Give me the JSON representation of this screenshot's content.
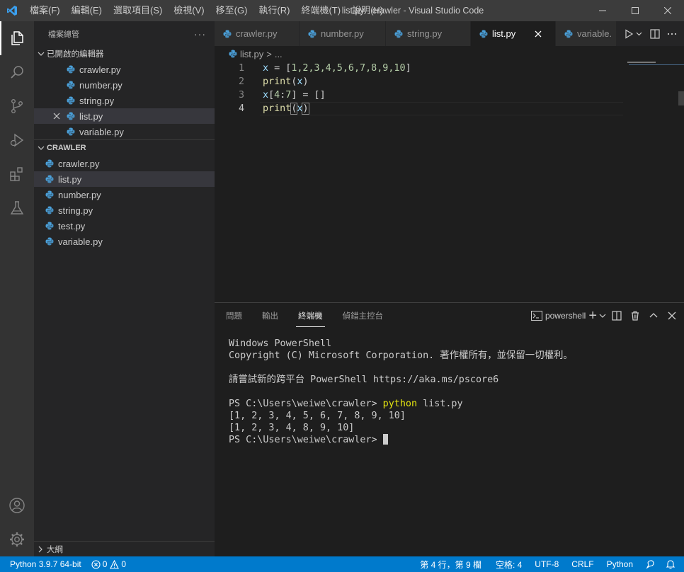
{
  "titlebar": {
    "menu": [
      "檔案(F)",
      "編輯(E)",
      "選取項目(S)",
      "檢視(V)",
      "移至(G)",
      "執行(R)",
      "終端機(T)",
      "說明(H)"
    ],
    "title": "list.py - crawler - Visual Studio Code"
  },
  "sidebar": {
    "header": "檔案總管",
    "more": "···",
    "open_editors_title": "已開啟的編輯器",
    "open_editors": [
      "crawler.py",
      "number.py",
      "string.py",
      "list.py",
      "variable.py"
    ],
    "folder_title": "CRAWLER",
    "files": [
      "crawler.py",
      "list.py",
      "number.py",
      "string.py",
      "test.py",
      "variable.py"
    ],
    "outline_title": "大綱"
  },
  "tabs": [
    "crawler.py",
    "number.py",
    "string.py",
    "list.py",
    "variable."
  ],
  "breadcrumb": {
    "file": "list.py",
    "sep": ">",
    "rest": "..."
  },
  "editor": {
    "line_numbers": [
      "1",
      "2",
      "3",
      "4"
    ],
    "l1": {
      "var": "x",
      "rest": " = [",
      "nums": "1,2,3,4,5,6,7,8,9,10",
      "end": "]"
    },
    "l2": {
      "fn": "print",
      "open": "(",
      "arg": "x",
      "close": ")"
    },
    "l3": {
      "var": "x",
      "open": "[",
      "a": "4",
      "colon": ":",
      "b": "7",
      "rest": "] = []"
    },
    "l4": {
      "fn": "print",
      "open": "(",
      "arg": "x",
      "close": ")"
    }
  },
  "panel": {
    "tabs": [
      "問題",
      "輸出",
      "終端機",
      "偵錯主控台"
    ],
    "terminal_name": "powershell",
    "add": "+",
    "terminal": {
      "l1": "Windows PowerShell",
      "l2": "Copyright (C) Microsoft Corporation. 著作權所有，並保留一切權利。",
      "l3": "請嘗試新的跨平台 PowerShell https://aka.ms/pscore6",
      "prompt": "PS C:\\Users\\weiwe\\crawler> ",
      "cmd": "python",
      "cmd_args": " list.py",
      "out1": "[1, 2, 3, 4, 5, 6, 7, 8, 9, 10]",
      "out2": "[1, 2, 3, 4, 8, 9, 10]",
      "prompt2": "PS C:\\Users\\weiwe\\crawler> "
    }
  },
  "statusbar": {
    "python": "Python 3.9.7 64-bit",
    "errors": "0",
    "warnings": "0",
    "position": "第 4 行，第 9 欄",
    "spaces": "空格: 4",
    "encoding": "UTF-8",
    "eol": "CRLF",
    "language": "Python"
  },
  "colors": {
    "accent": "#007acc",
    "python_icon": "#4a9fd8",
    "terminal_cmd": "#e5e510"
  }
}
